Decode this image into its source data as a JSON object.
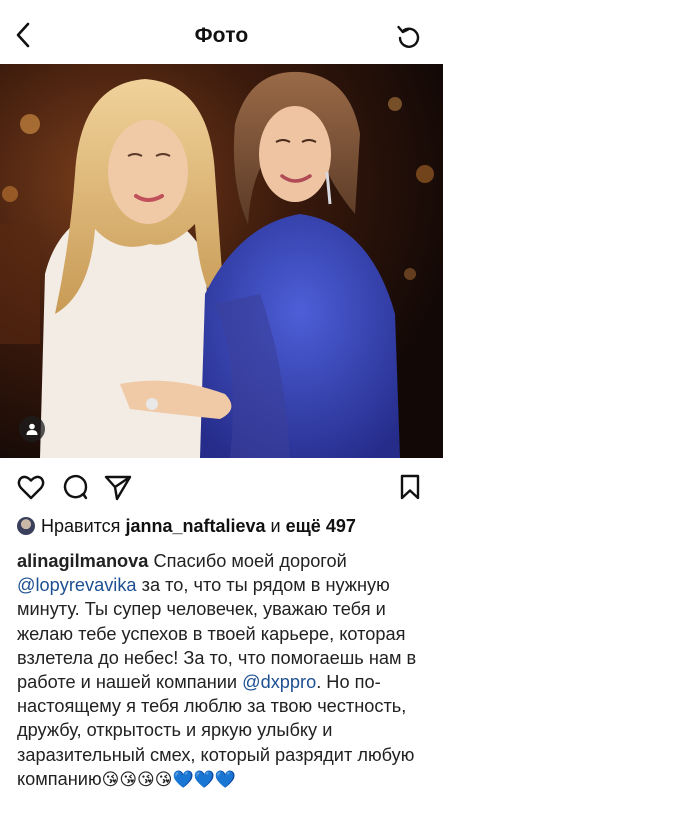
{
  "header": {
    "title": "Фото"
  },
  "likes": {
    "prefix": "Нравится",
    "user": "janna_naftalieva",
    "and_text": "и",
    "more": "ещё 497"
  },
  "caption": {
    "username": "alinagilmanova",
    "part1": "Спасибо моей дорогой",
    "mention1": "@lopyrevavika",
    "part2": "за то, что ты рядом в нужную минуту. Ты супер человечек, уважаю тебя и желаю тебе успехов в твоей карьере, которая взлетела до небес! За то, что помогаешь нам в работе и нашей компании",
    "mention2": "@dxppro",
    "part3": ". Но по-настоящему я тебя люблю за твою честность, дружбу, открытость и яркую улыбку и заразительный смех, который разрядит любую компанию",
    "emojis": "😘😘😘😘💙💙💙"
  },
  "colors": {
    "mention": "#1d4f91",
    "text": "#111111"
  },
  "icons": [
    "chevron-left-icon",
    "refresh-icon",
    "heart-icon",
    "comment-icon",
    "share-icon",
    "bookmark-icon",
    "user-tag-icon"
  ]
}
